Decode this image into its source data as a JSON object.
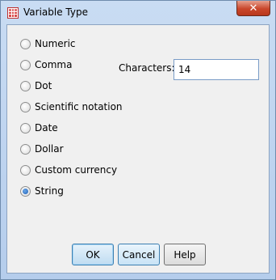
{
  "window": {
    "title": "Variable Type",
    "close_label": "✕"
  },
  "types": [
    {
      "label": "Numeric",
      "checked": false
    },
    {
      "label": "Comma",
      "checked": false
    },
    {
      "label": "Dot",
      "checked": false
    },
    {
      "label": "Scientific notation",
      "checked": false
    },
    {
      "label": "Date",
      "checked": false
    },
    {
      "label": "Dollar",
      "checked": false
    },
    {
      "label": "Custom currency",
      "checked": false
    },
    {
      "label": "String",
      "checked": true
    }
  ],
  "characters": {
    "label": "Characters:",
    "value": "14"
  },
  "buttons": {
    "ok": "OK",
    "cancel": "Cancel",
    "help": "Help"
  }
}
